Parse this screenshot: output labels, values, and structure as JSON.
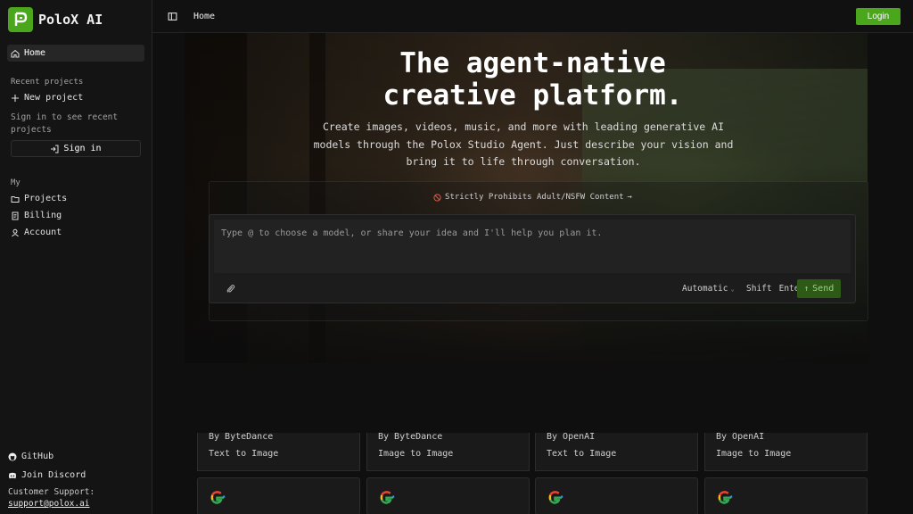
{
  "brand": {
    "name": "PoloX AI",
    "accent": "#4aa61a"
  },
  "sidebar": {
    "home_label": "Home",
    "recent_projects_label": "Recent projects",
    "new_project_label": "New project",
    "signin_note": "Sign in to see recent projects",
    "signin_label": "Sign in",
    "my_label": "My",
    "my_items": [
      {
        "label": "Projects",
        "icon": "folder-icon"
      },
      {
        "label": "Billing",
        "icon": "billing-icon"
      },
      {
        "label": "Account",
        "icon": "user-icon"
      }
    ],
    "github_label": "GitHub",
    "discord_label": "Join Discord",
    "support_label": "Customer Support:",
    "support_email": "support@polox.ai"
  },
  "topbar": {
    "breadcrumb": "Home",
    "login_label": "Login"
  },
  "hero": {
    "title_line1": "The agent-native",
    "title_line2": "creative platform.",
    "subtitle": "Create images, videos, music, and more with leading generative AI models through the Polox Studio Agent. Just describe your vision and bring it to life through conversation.",
    "notice": "Strictly Prohibits Adult/NSFW Content"
  },
  "composer": {
    "placeholder": "Type @ to choose a model, or share your idea and I'll help you plan it.",
    "mode": "Automatic",
    "shortcut_1": "Shift",
    "shortcut_2": "Enter",
    "send_label": "Send"
  },
  "models": [
    {
      "by": "By ByteDance",
      "kind": "Text to Image"
    },
    {
      "by": "By ByteDance",
      "kind": "Image to Image"
    },
    {
      "by": "By OpenAI",
      "kind": "Text to Image"
    },
    {
      "by": "By OpenAI",
      "kind": "Image to Image"
    }
  ],
  "google_cards": [
    {
      "icon": "google-icon"
    },
    {
      "icon": "google-icon"
    },
    {
      "icon": "google-icon"
    },
    {
      "icon": "google-icon"
    }
  ]
}
